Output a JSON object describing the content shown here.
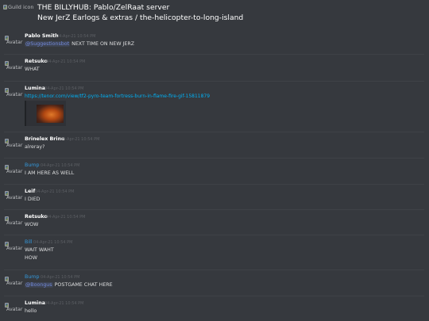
{
  "header": {
    "guild_icon_alt": "Guild icon",
    "line1": "THE BILLYHUB: Pablo/ZelRaat server",
    "line2": "New JerZ Earlogs & extras / the-helicopter-to-long-island"
  },
  "avatar_alt": "Avatar",
  "messages": [
    {
      "author": "Pablo Smith",
      "timestamp": "04-Apr-21 10:54 PM",
      "mention": "@Suggestionsbot",
      "text": " NEXT TIME ON NEW JERZ",
      "author_color": "#ffffff"
    },
    {
      "author": "Retsuko",
      "timestamp": "04-Apr-21 10:54 PM",
      "text": "WHAT",
      "author_color": "#ffffff"
    },
    {
      "author": "Lumina",
      "timestamp": "04-Apr-21 10:54 PM",
      "link": "https://tenor.com/view/tf2-pyro-team-fortress-burn-in-flame-fire-gif-15811879",
      "author_color": "#ffffff"
    },
    {
      "author": "Brinelex Brine",
      "timestamp": "04-Apr-21 10:54 PM",
      "text": "alreray?",
      "author_color": "#ffffff"
    },
    {
      "author": "Bump",
      "timestamp": "04-Apr-21 10:54 PM",
      "text": "I AM HERE AS WELL",
      "author_color": "#3498db"
    },
    {
      "author": "Leif",
      "timestamp": "04-Apr-21 10:54 PM",
      "text": "I DIED",
      "author_color": "#ffffff"
    },
    {
      "author": "Retsuko",
      "timestamp": "04-Apr-21 10:54 PM",
      "text": "WOW",
      "author_color": "#ffffff"
    },
    {
      "author": "Bill",
      "timestamp": "04-Apr-21 10:54 PM",
      "text": "WAIT WAHT",
      "text2": "HOW",
      "author_color": "#3498db"
    },
    {
      "author": "Bump",
      "timestamp": "04-Apr-21 10:54 PM",
      "mention": "@Boongus",
      "text": " POSTGAME CHAT HERE",
      "author_color": "#3498db"
    },
    {
      "author": "Lumina",
      "timestamp": "04-Apr-21 10:54 PM",
      "text": "hello",
      "author_color": "#ffffff"
    }
  ]
}
